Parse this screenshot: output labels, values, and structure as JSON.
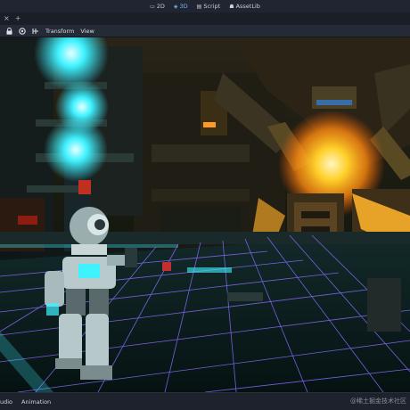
{
  "workspaces": [
    {
      "label": "2D",
      "icon": "2d-icon"
    },
    {
      "label": "3D",
      "icon": "3d-icon",
      "active": true
    },
    {
      "label": "Script",
      "icon": "script-icon"
    },
    {
      "label": "AssetLib",
      "icon": "assetlib-icon"
    }
  ],
  "tabbar": {
    "close_glyph": "×",
    "add_glyph": "+"
  },
  "toolbar": {
    "icons": [
      "lock-icon",
      "group-icon",
      "grid-snap-icon"
    ],
    "menus": [
      "Transform",
      "View"
    ]
  },
  "bottom_panel": {
    "tabs": [
      "udio",
      "Animation"
    ]
  },
  "watermark": "@稀土掘金技术社区",
  "colors": {
    "accent": "#78b6ff",
    "grid": "#8a6cff",
    "glow_cyan": "#3ff2ff",
    "glow_orange": "#ffb21a"
  }
}
